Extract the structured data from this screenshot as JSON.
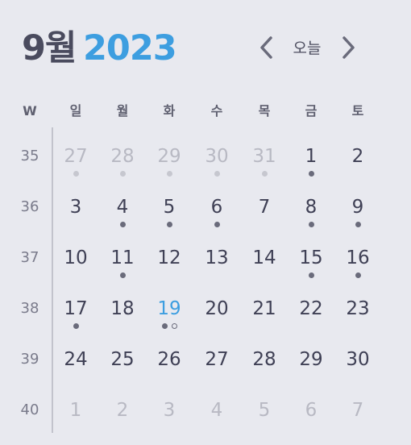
{
  "header": {
    "month": "9월",
    "year": "2023",
    "today_label": "오늘",
    "prev_icon": "chevron-left-icon",
    "next_icon": "chevron-right-icon"
  },
  "weekday_header": {
    "week_label": "W",
    "days": [
      "일",
      "월",
      "화",
      "수",
      "목",
      "금",
      "토"
    ]
  },
  "colors": {
    "accent": "#3d9ee0",
    "text": "#3f4055",
    "muted": "#b8b9c3",
    "background": "#e8e9ef"
  },
  "weeks": [
    {
      "week": "35",
      "days": [
        {
          "n": "27",
          "other": true,
          "dots": 1
        },
        {
          "n": "28",
          "other": true,
          "dots": 1
        },
        {
          "n": "29",
          "other": true,
          "dots": 1
        },
        {
          "n": "30",
          "other": true,
          "dots": 1
        },
        {
          "n": "31",
          "other": true,
          "dots": 1
        },
        {
          "n": "1",
          "dots": 1
        },
        {
          "n": "2"
        }
      ]
    },
    {
      "week": "36",
      "days": [
        {
          "n": "3"
        },
        {
          "n": "4",
          "dots": 1
        },
        {
          "n": "5",
          "dots": 1
        },
        {
          "n": "6",
          "dots": 1
        },
        {
          "n": "7"
        },
        {
          "n": "8",
          "dots": 1
        },
        {
          "n": "9",
          "dots": 1
        }
      ]
    },
    {
      "week": "37",
      "days": [
        {
          "n": "10"
        },
        {
          "n": "11",
          "dots": 1
        },
        {
          "n": "12"
        },
        {
          "n": "13"
        },
        {
          "n": "14"
        },
        {
          "n": "15",
          "dots": 1
        },
        {
          "n": "16",
          "dots": 1
        }
      ]
    },
    {
      "week": "38",
      "days": [
        {
          "n": "17",
          "dots": 1
        },
        {
          "n": "18"
        },
        {
          "n": "19",
          "today": true,
          "dots": 1,
          "hollow": 1
        },
        {
          "n": "20"
        },
        {
          "n": "21"
        },
        {
          "n": "22"
        },
        {
          "n": "23"
        }
      ]
    },
    {
      "week": "39",
      "days": [
        {
          "n": "24"
        },
        {
          "n": "25"
        },
        {
          "n": "26"
        },
        {
          "n": "27"
        },
        {
          "n": "28"
        },
        {
          "n": "29"
        },
        {
          "n": "30"
        }
      ]
    },
    {
      "week": "40",
      "days": [
        {
          "n": "1",
          "other": true
        },
        {
          "n": "2",
          "other": true
        },
        {
          "n": "3",
          "other": true
        },
        {
          "n": "4",
          "other": true
        },
        {
          "n": "5",
          "other": true
        },
        {
          "n": "6",
          "other": true
        },
        {
          "n": "7",
          "other": true
        }
      ]
    }
  ]
}
